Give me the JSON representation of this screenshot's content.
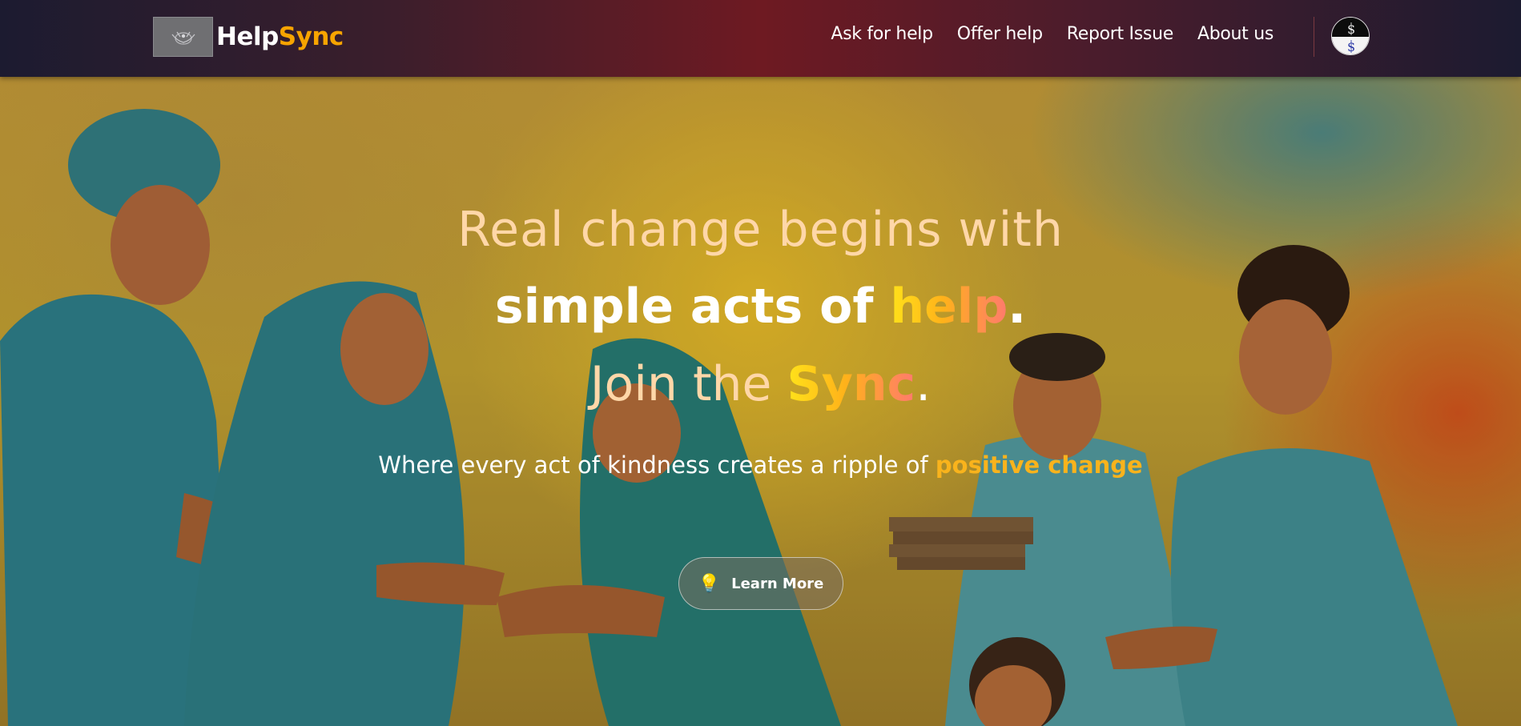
{
  "brand": {
    "name_part1": "Help",
    "name_part2": "Sync",
    "logo_icon": "helpsync-logo",
    "colors": {
      "primary": "#ffffff",
      "accent": "#f7a400"
    }
  },
  "nav": {
    "links": [
      {
        "label": "Ask for help"
      },
      {
        "label": "Offer help"
      },
      {
        "label": "Report Issue"
      },
      {
        "label": "About us"
      }
    ],
    "avatar_icon": "user-avatar"
  },
  "hero": {
    "line1": "Real change begins with",
    "line2_main": "simple acts of ",
    "line2_accent": "help",
    "line2_end": ".",
    "line3_main": "Join the ",
    "line3_accent": "Sync",
    "line3_end": ".",
    "tagline_main": "Where every act of kindness creates a ripple of ",
    "tagline_accent": "positive change",
    "cta": {
      "icon": "lightbulb-icon",
      "label": "Learn More"
    },
    "colors": {
      "headline": "#ffd7a8",
      "gradient_start": "#ffe21a",
      "gradient_end": "#ff7a6e",
      "tagline_accent": "#f9b31c"
    }
  }
}
